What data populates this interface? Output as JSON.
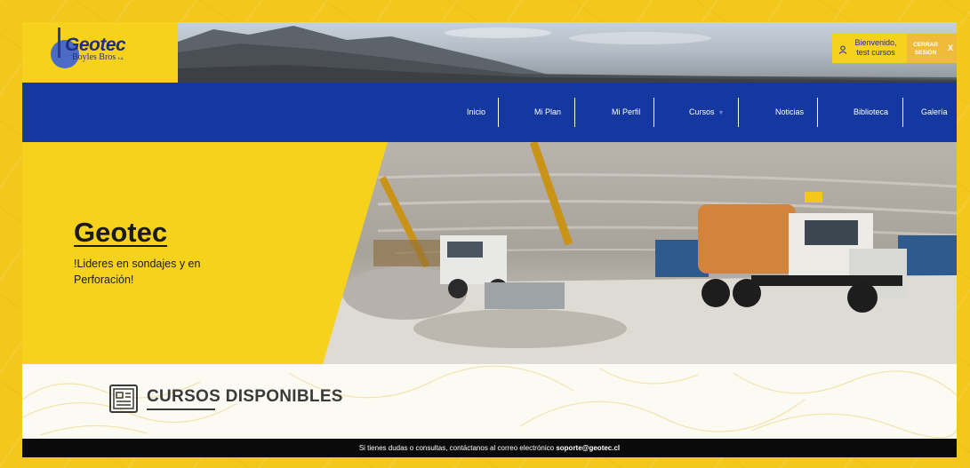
{
  "brand": {
    "name": "Geotec",
    "subtitle": "Boyles Bros",
    "subtitle_suffix": "s.a.",
    "colors": {
      "yellow": "#f6d21c",
      "blue": "#1538a0",
      "dark": "#0a0a0a"
    }
  },
  "header": {
    "welcome_line1": "Bienvenido,",
    "welcome_line2": "test cursos",
    "logout_line1": "CERRAR",
    "logout_line2": "SESIÓN",
    "close_label": "X",
    "user_icon": "user-icon"
  },
  "nav": {
    "items": [
      {
        "label": "Inicio"
      },
      {
        "label": "Mi Plan"
      },
      {
        "label": "Mi Perfil"
      },
      {
        "label": "Cursos",
        "has_dropdown": true
      },
      {
        "label": "Noticias"
      },
      {
        "label": "Biblioteca"
      },
      {
        "label": "Galería"
      }
    ]
  },
  "hero": {
    "title": "Geotec",
    "subtitle": "!Lideres en sondajes y en Perforación!"
  },
  "courses": {
    "title": "CURSOS DISPONIBLES",
    "icon": "document-list-icon"
  },
  "footer": {
    "text": "Si tienes dudas o consultas, contáctanos al correo electrónico",
    "email": "soporte@geotec.cl"
  }
}
